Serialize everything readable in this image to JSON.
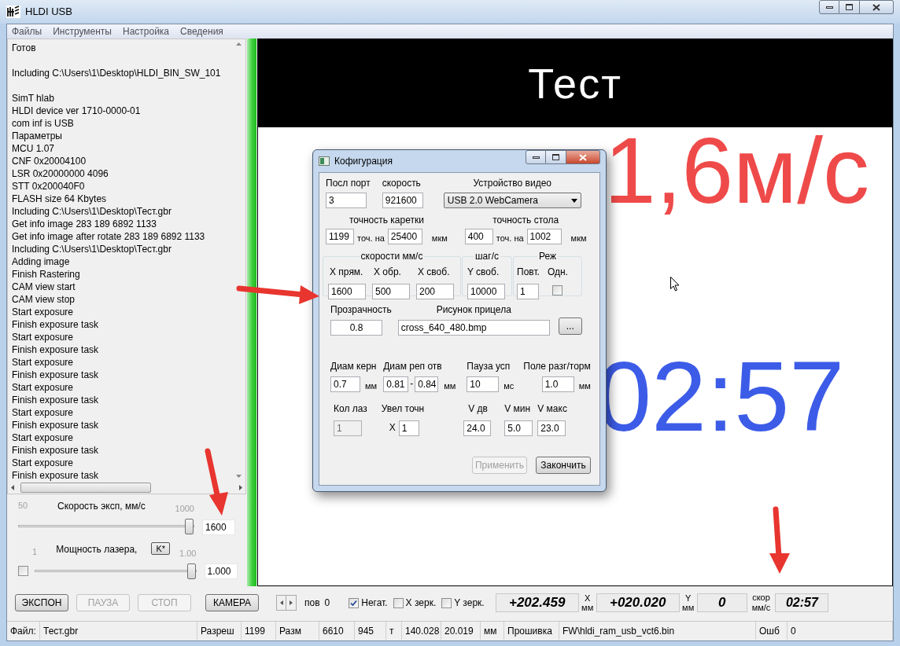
{
  "window": {
    "title": "HLDI USB"
  },
  "menu": [
    "Файлы",
    "Инструменты",
    "Настройка",
    "Сведения"
  ],
  "log_blocks": [
    [
      "Готов"
    ],
    [
      "Including C:\\Users\\1\\Desktop\\HLDI_BIN_SW_101"
    ],
    [
      "SimT hlab",
      "HLDI device ver 1710-0000-01",
      "com inf is USB",
      "Параметры",
      "MCU 1.07",
      "CNF 0x20004100",
      "LSR 0x20000000 4096",
      "STT 0x200040F0",
      "FLASH size 64 Kbytes",
      "Including C:\\Users\\1\\Desktop\\Тест.gbr",
      "Get info image 283 189 6892 1133",
      "Get info image after rotate 283 189 6892 1133",
      "Including C:\\Users\\1\\Desktop\\Тест.gbr",
      "Adding image",
      "Finish Rastering",
      "CAM view start",
      "CAM view stop",
      "Start exposure",
      "Finish exposure task",
      "Start exposure",
      "Finish exposure task",
      "Start exposure",
      "Finish exposure task",
      "Start exposure",
      "Finish exposure task",
      "Start exposure",
      "Finish exposure task",
      "Start exposure",
      "Finish exposure task",
      "Start exposure",
      "Finish exposure task"
    ]
  ],
  "speed_slider": {
    "min_label": "50",
    "title": "Скорость эксп, мм/с",
    "max_label": "1000",
    "level": 1,
    "value": "1600"
  },
  "power_slider": {
    "min_label": "1",
    "title": "Мощность лазера,",
    "k_button": "K*",
    "max_label": "1.00",
    "level": 1,
    "value": "1.000",
    "checked": false
  },
  "buttons": [
    {
      "label": "ЭКСПОН",
      "disabled": false
    },
    {
      "label": "ПАУЗА",
      "disabled": true
    },
    {
      "label": "СТОП",
      "disabled": true
    },
    {
      "label": "КАМЕРА",
      "disabled": false
    }
  ],
  "progress": {
    "level": 1
  },
  "canvas": {
    "banner": "Тест",
    "speed_overlay": "1,6м/с",
    "timer_overlay": "02:57"
  },
  "dialog": {
    "title": "Кофигурация",
    "port": {
      "label": "Посл порт",
      "value": "3"
    },
    "baud": {
      "label": "скорость",
      "value": "921600"
    },
    "video": {
      "label": "Устройство видео",
      "value": "USB 2.0 WebCamera"
    },
    "carriage": {
      "title": "точность каретки",
      "points": "1199",
      "per": "точ. на",
      "distance": "25400",
      "unit": "мкм"
    },
    "table": {
      "title": "точность стола",
      "points": "400",
      "per": "точ. на",
      "distance": "1002",
      "unit": "мкм"
    },
    "speeds": {
      "title": "скорости мм/с",
      "fields": [
        {
          "label": "X прям.",
          "value": "1600"
        },
        {
          "label": "X обр.",
          "value": "500"
        },
        {
          "label": "X своб.",
          "value": "200"
        }
      ]
    },
    "step": {
      "title": "шаг/с",
      "label": "Y своб.",
      "value": "10000"
    },
    "mode": {
      "title": "Реж",
      "repeat_label": "Повт.",
      "repeat_value": "1",
      "single_label": "Одн.",
      "single_checked": false
    },
    "transparency": {
      "label": "Прозрачность",
      "value": "0.8"
    },
    "crosshair": {
      "label": "Рисунок прицела",
      "value": "cross_640_480.bmp",
      "browse": "..."
    },
    "core_diam": {
      "label": "Диам керн",
      "value": "0.7",
      "unit": "мм"
    },
    "hole_diam": {
      "label": "Диам реп отв",
      "from": "0.81",
      "dash": "-",
      "to": "0.84",
      "unit": "мм"
    },
    "pause": {
      "label": "Пауза усп",
      "value": "10",
      "unit": "мс"
    },
    "accel": {
      "label": "Поле разг/торм",
      "value": "1.0",
      "unit": "мм"
    },
    "laser_count": {
      "label": "Кол лаз",
      "value": "1",
      "disabled": true
    },
    "zoom": {
      "label": "Увел точн",
      "prefix": "X",
      "value": "1"
    },
    "v_move": {
      "label": "V дв",
      "value": "24.0"
    },
    "v_min": {
      "label": "V мин",
      "value": "5.0"
    },
    "v_max": {
      "label": "V макс",
      "value": "23.0"
    },
    "buttons": [
      {
        "label": "Применить",
        "disabled": true
      },
      {
        "label": "Закончить",
        "disabled": false
      }
    ]
  },
  "toolbar": {
    "rotation_label": "пов",
    "rotation_value": "0",
    "checkboxes": [
      {
        "label": "Негат.",
        "checked": true
      },
      {
        "label": "X зерк.",
        "checked": false
      },
      {
        "label": "Y зерк.",
        "checked": false
      }
    ],
    "x": {
      "value": "+202.459",
      "axis": "X",
      "unit": "мм"
    },
    "y": {
      "value": "+020.020",
      "axis": "Y",
      "unit": "мм"
    },
    "speed": {
      "value": "0",
      "label": "скор",
      "unit": "мм/с"
    },
    "time": "02:57"
  },
  "status_bar": [
    "Файл:",
    "Тест.gbr",
    "Разреш",
    "1199",
    "Разм",
    "6610",
    "945",
    "т",
    "140.028",
    "20.019",
    "мм",
    "Прошивка",
    "FW\\hldi_ram_usb_vct6.bin",
    "Ошб",
    "0"
  ]
}
